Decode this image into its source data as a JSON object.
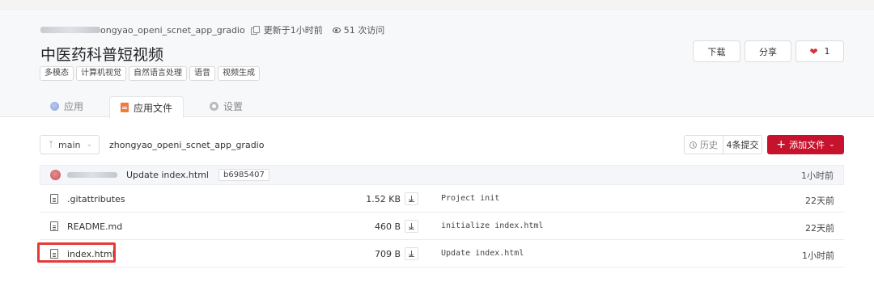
{
  "repo": {
    "name_suffix": "ongyao_openi_scnet_app_gradio",
    "updated": "更新于1小时前",
    "visits": "51 次访问",
    "title": "中医药科普短视频",
    "tags": [
      "多模态",
      "计算机视觉",
      "自然语言处理",
      "语音",
      "视频生成"
    ]
  },
  "actions": {
    "download": "下载",
    "share": "分享",
    "likes": "1"
  },
  "tabs": [
    {
      "label": "应用",
      "active": false
    },
    {
      "label": "应用文件",
      "active": true
    },
    {
      "label": "设置",
      "active": false
    }
  ],
  "toolbar": {
    "branch": "main",
    "path": "zhongyao_openi_scnet_app_gradio",
    "history": "历史",
    "commits": "4条提交",
    "add_file": "添加文件"
  },
  "latest_commit": {
    "message": "Update index.html",
    "sha": "b6985407",
    "time": "1小时前"
  },
  "files": [
    {
      "name": ".gitattributes",
      "size": "1.52 KB",
      "commit": "Project init",
      "time": "22天前",
      "highlighted": false
    },
    {
      "name": "README.md",
      "size": "460 B",
      "commit": "initialize index.html",
      "time": "22天前",
      "highlighted": false
    },
    {
      "name": "index.html",
      "size": "709 B",
      "commit": "Update index.html",
      "time": "1小时前",
      "highlighted": true
    }
  ],
  "colors": {
    "primary_red": "#c7122d",
    "highlight_red": "#e43a3a",
    "header_bg": "#f7f8fa"
  }
}
